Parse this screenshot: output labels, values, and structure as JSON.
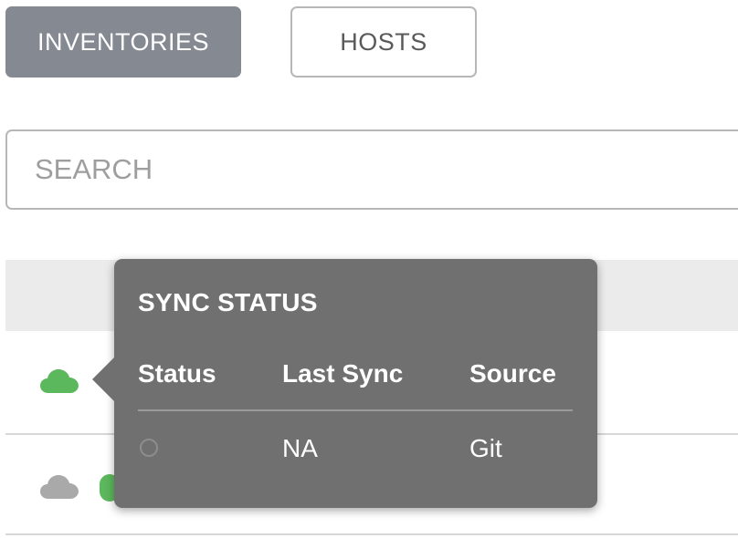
{
  "tabs": {
    "inventories_label": "INVENTORIES",
    "hosts_label": "HOSTS",
    "active": "INVENTORIES"
  },
  "search": {
    "placeholder": "SEARCH",
    "value": ""
  },
  "list": {
    "rows": [
      {
        "cloud_status": "success",
        "cloud_icon": "cloud-icon"
      },
      {
        "cloud_status": "none",
        "cloud_icon": "cloud-icon"
      }
    ]
  },
  "popover": {
    "title": "SYNC STATUS",
    "columns": [
      "Status",
      "Last Sync",
      "Source"
    ],
    "rows": [
      {
        "status_icon": "empty-circle-icon",
        "last_sync": "NA",
        "source": "Git"
      }
    ]
  },
  "colors": {
    "active_tab": "#848992",
    "popover_bg": "#707070",
    "success_green": "#5cb85c",
    "inactive_gray": "#9e9e9e",
    "header_bg": "#ebebeb"
  }
}
